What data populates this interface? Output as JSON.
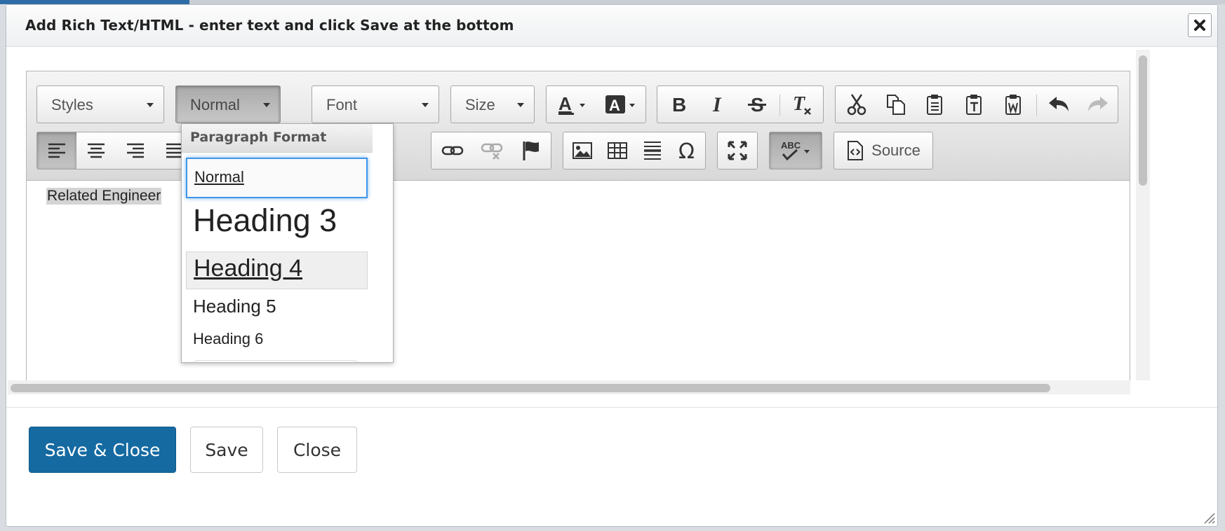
{
  "dialog": {
    "title": "Add Rich Text/HTML - enter text and click Save at the bottom"
  },
  "toolbar": {
    "styles_label": "Styles",
    "format_label": "Normal",
    "font_label": "Font",
    "size_label": "Size",
    "source_label": "Source"
  },
  "format_menu": {
    "header": "Paragraph Format",
    "items": [
      "Normal",
      "Heading 3",
      "Heading 4",
      "Heading 5",
      "Heading 6"
    ]
  },
  "content": {
    "text": "Related Engineer"
  },
  "footer": {
    "save_close": "Save & Close",
    "save": "Save",
    "close": "Close"
  },
  "colors": {
    "primary": "#156aa1",
    "focus": "#3e95e8"
  }
}
